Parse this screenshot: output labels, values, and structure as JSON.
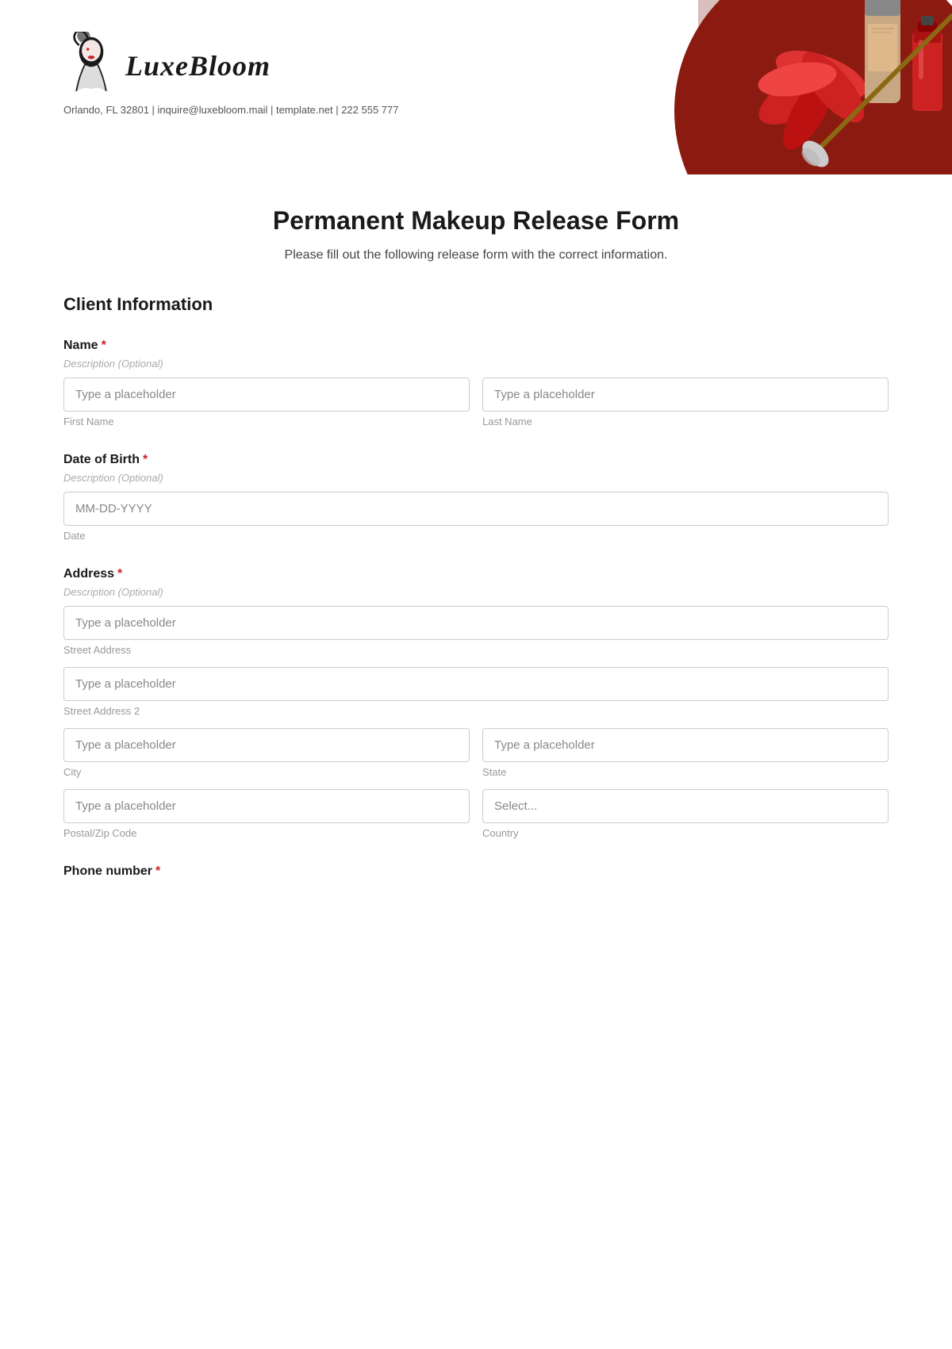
{
  "header": {
    "logo_brand": "LuxeBloom",
    "logo_lux": "Luxe",
    "logo_bloom": "Bloom",
    "contact_info": "Orlando, FL 32801 | inquire@luxebloom.mail | template.net | 222 555 777"
  },
  "form": {
    "title": "Permanent Makeup Release Form",
    "subtitle": "Please fill out the following release form with the correct information.",
    "section_client": "Client Information",
    "fields": {
      "name": {
        "label": "Name",
        "required": true,
        "description": "Description (Optional)",
        "first_name": {
          "placeholder": "Type a placeholder",
          "sublabel": "First Name"
        },
        "last_name": {
          "placeholder": "Type a placeholder",
          "sublabel": "Last Name"
        }
      },
      "dob": {
        "label": "Date of Birth",
        "required": true,
        "description": "Description (Optional)",
        "placeholder": "MM-DD-YYYY",
        "sublabel": "Date"
      },
      "address": {
        "label": "Address",
        "required": true,
        "description": "Description (Optional)",
        "street1": {
          "placeholder": "Type a placeholder",
          "sublabel": "Street Address"
        },
        "street2": {
          "placeholder": "Type a placeholder",
          "sublabel": "Street Address 2"
        },
        "city": {
          "placeholder": "Type a placeholder",
          "sublabel": "City"
        },
        "state": {
          "placeholder": "Type a placeholder",
          "sublabel": "State"
        },
        "postal": {
          "placeholder": "Type a placeholder",
          "sublabel": "Postal/Zip Code"
        },
        "country": {
          "placeholder": "Select...",
          "sublabel": "Country"
        }
      },
      "phone": {
        "label": "Phone number",
        "required": true
      }
    }
  },
  "colors": {
    "accent_red": "#cc2222",
    "dark_red": "#a02020",
    "border_gray": "#cccccc",
    "text_dark": "#1a1a1a",
    "text_muted": "#999999",
    "text_placeholder": "#888888",
    "required_star": "#cc2222"
  }
}
